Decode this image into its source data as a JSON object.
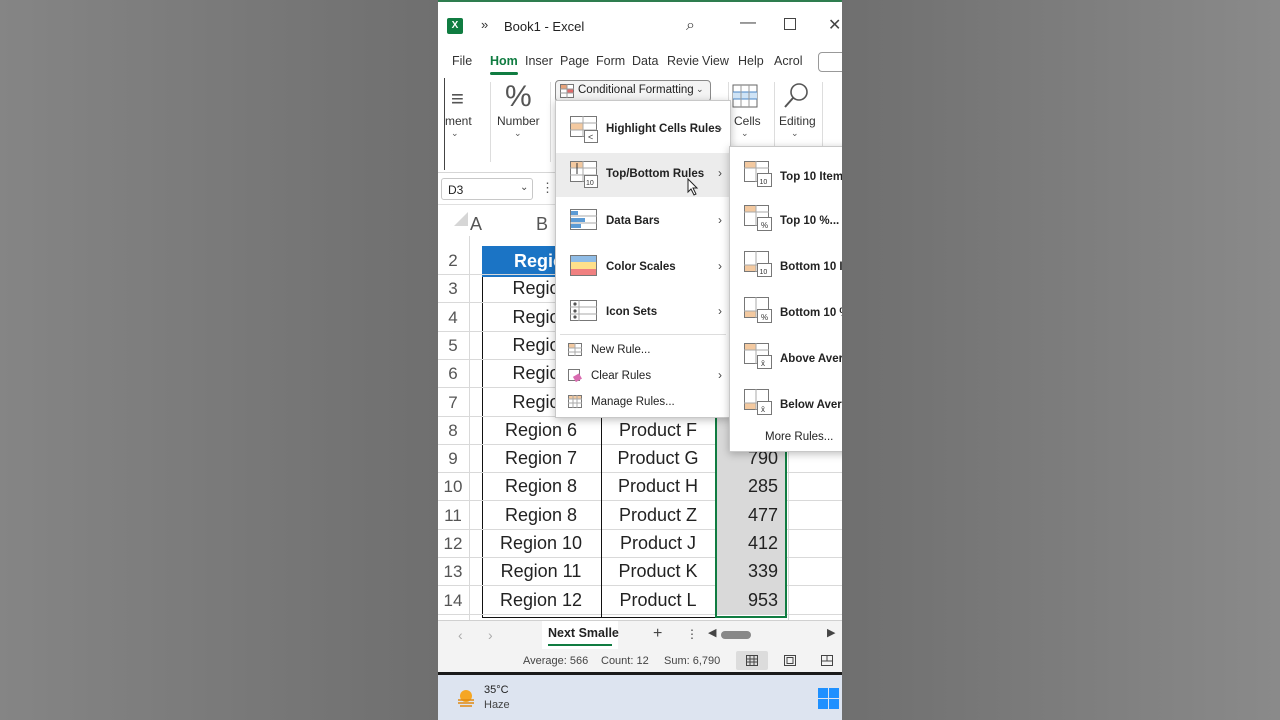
{
  "window": {
    "title": "Book1  -  Excel"
  },
  "ribbon_tabs": [
    "File",
    "Hom",
    "Inser",
    "Page",
    "Form",
    "Data",
    "Revie",
    "View",
    "Help",
    "Acrol"
  ],
  "ribbon": {
    "alignment_label": "ment",
    "number_label": "Number",
    "conditional_formatting_label": "Conditional Formatting",
    "cells_label": "Cells",
    "editing_label": "Editing"
  },
  "name_box": "D3",
  "columns": [
    "A",
    "B"
  ],
  "header_cell": "Regio",
  "rows": [
    {
      "num": "2",
      "b": "",
      "c": "",
      "d": ""
    },
    {
      "num": "3",
      "b": "Region",
      "c": "",
      "d": ""
    },
    {
      "num": "4",
      "b": "Region",
      "c": "",
      "d": ""
    },
    {
      "num": "5",
      "b": "Region",
      "c": "",
      "d": ""
    },
    {
      "num": "6",
      "b": "Region",
      "c": "",
      "d": ""
    },
    {
      "num": "7",
      "b": "Region",
      "c": "",
      "d": ""
    },
    {
      "num": "8",
      "b": "Region 6",
      "c": "Product F",
      "d": ""
    },
    {
      "num": "9",
      "b": "Region 7",
      "c": "Product G",
      "d": "790"
    },
    {
      "num": "10",
      "b": "Region 8",
      "c": "Product H",
      "d": "285"
    },
    {
      "num": "11",
      "b": "Region 8",
      "c": "Product Z",
      "d": "477"
    },
    {
      "num": "12",
      "b": "Region 10",
      "c": "Product J",
      "d": "412"
    },
    {
      "num": "13",
      "b": "Region 11",
      "c": "Product K",
      "d": "339"
    },
    {
      "num": "14",
      "b": "Region 12",
      "c": "Product L",
      "d": "953"
    }
  ],
  "cf_menu": {
    "items": [
      "Highlight Cells Rules",
      "Top/Bottom Rules",
      "Data Bars",
      "Color Scales",
      "Icon Sets"
    ],
    "small_items": [
      "New Rule...",
      "Clear Rules",
      "Manage Rules..."
    ]
  },
  "topbottom_menu": {
    "items": [
      "Top 10 Item",
      "Top 10 %...",
      "Bottom 10 I",
      "Bottom 10 %",
      "Above Aver",
      "Below Avera"
    ],
    "more": "More Rules..."
  },
  "sheet": {
    "tab_name": "Next Smalle"
  },
  "status": {
    "average": "Average:  566",
    "count": "Count:  12",
    "sum": "Sum:  6,790"
  },
  "taskbar": {
    "temperature": "35°C",
    "weather": "Haze"
  }
}
